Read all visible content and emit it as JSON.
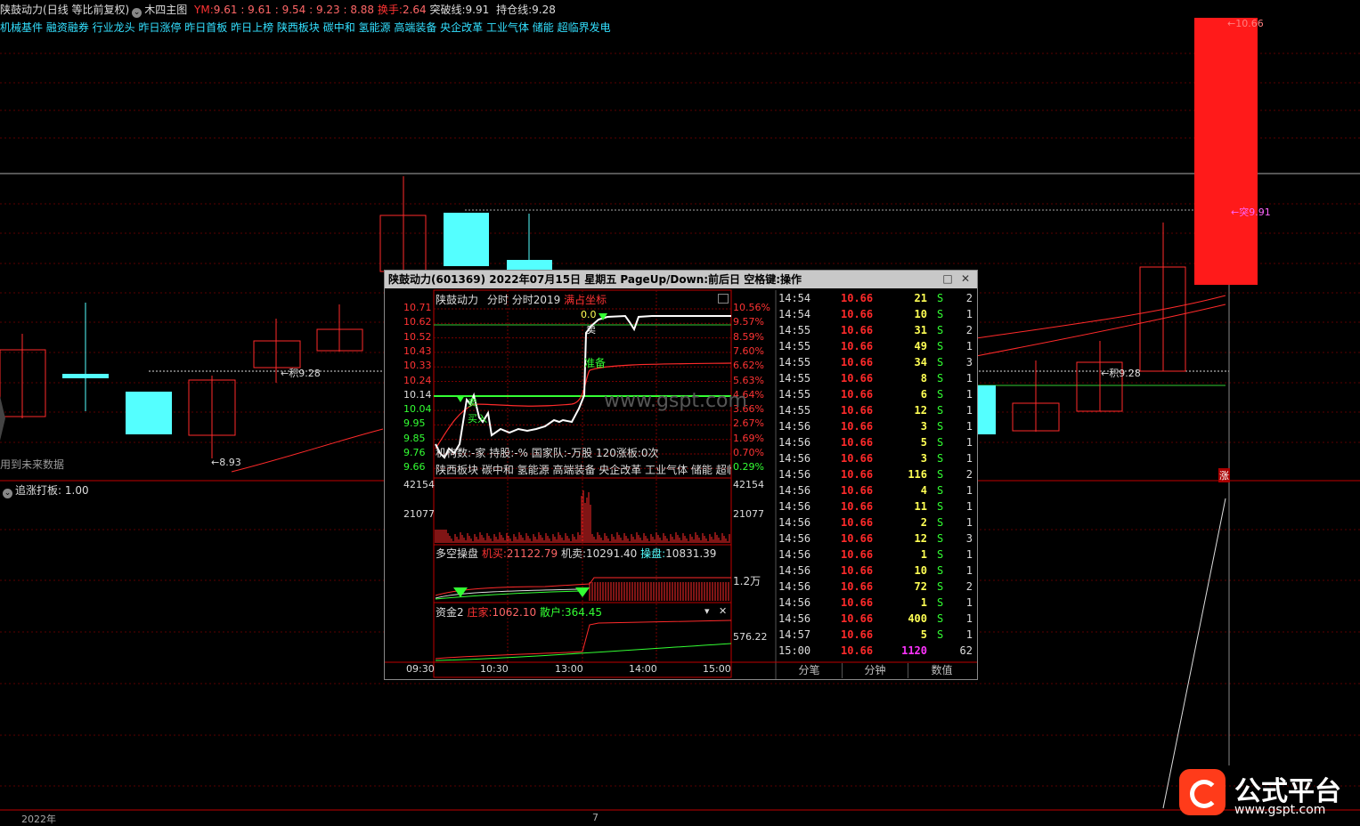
{
  "header": {
    "stock_name": "陕鼓动力",
    "chart_mode": "(日线 等比前复权)",
    "indicator_name": "木四主图",
    "ym_label": "YM:",
    "ym_values": "9.61 : 9.61 : 9.54 : 9.23 : 8.88",
    "turnover_label": "换手:",
    "turnover_value": "2.64",
    "breakout_label": "突破线:",
    "breakout_value": "9.91",
    "hold_label": "持仓线:",
    "hold_value": "9.28"
  },
  "concepts": "机械基件 融资融券 行业龙头 昨日涨停 昨日首板 昨日上榜 陕西板块 碳中和 氢能源 高端装备 央企改革 工业气体 储能 超临界发电",
  "main_chart": {
    "price_high_label": "←10.66",
    "breakout_label": "←突9.91",
    "hold_label_left": "←积9.28",
    "hold_label_right": "←积9.28",
    "low_label": "←8.93",
    "future_data_label": "用到未来数据",
    "zhang_label": "涨"
  },
  "sub_indicator": {
    "name": "追涨打板",
    "value": ": 1.00"
  },
  "bottom_axis": {
    "year_label": "2022年",
    "month_label": "7"
  },
  "colors": {
    "up": "#ff2a2a",
    "down": "#54ffff",
    "accent_yellow": "#ffff54",
    "green": "#33ff33",
    "magenta": "#ff33ff"
  },
  "popup": {
    "title": "陕鼓动力(601369) 2022年07月15日 星期五 PageUp/Down:前后日 空格键:操作",
    "chart_title": "陕鼓动力",
    "tab_fenshi": "分时",
    "tab_fenshi2019": "分时2019",
    "tab_full": "满占坐标",
    "left_prices": [
      "10.71",
      "10.62",
      "10.52",
      "10.43",
      "10.33",
      "10.24",
      "10.14",
      "10.04",
      "9.95",
      "9.85",
      "9.76",
      "9.66"
    ],
    "right_pcts": [
      "10.56%",
      "9.57%",
      "8.59%",
      "7.60%",
      "6.62%",
      "5.63%",
      "4.64%",
      "3.66%",
      "2.67%",
      "1.69%",
      "0.70%",
      "0.29%"
    ],
    "label_mai": "卖",
    "label_zhunbei": "准备",
    "label_mai2": "卖",
    "label_mairu": "买入",
    "label_top": "0.0",
    "info_line": "机构数:-家 持股:-% 国家队:-万股 120涨板:0次",
    "concept_line": "陕西板块 碳中和 氢能源 高端装备 央企改革 工业气体 储能 超临",
    "vol_top": "42154",
    "vol_mid": "21077",
    "duokong_label": "多空操盘",
    "jimai_label": "机买:",
    "jimai_value": "21122.79",
    "jimai2_label": "机卖:",
    "jimai2_value": "10291.40",
    "caopan_label": "操盘:",
    "caopan_value": "10831.39",
    "duokong_axis": "1.2万",
    "zijin_label": "资金2",
    "zhuangjia_label": "庄家:",
    "zhuangjia_value": "1062.10",
    "sanhu_label": "散户:",
    "sanhu_value": "364.45",
    "zijin_axis": "576.22",
    "time_labels": [
      "09:30",
      "10:30",
      "13:00",
      "14:00",
      "15:00"
    ],
    "watermark": "www.gspt.com",
    "ticks": [
      {
        "time": "14:54",
        "price": "10.66",
        "vol": "21",
        "side": "S",
        "n": "2"
      },
      {
        "time": "14:54",
        "price": "10.66",
        "vol": "10",
        "side": "S",
        "n": "1"
      },
      {
        "time": "14:55",
        "price": "10.66",
        "vol": "31",
        "side": "S",
        "n": "2"
      },
      {
        "time": "14:55",
        "price": "10.66",
        "vol": "49",
        "side": "S",
        "n": "1"
      },
      {
        "time": "14:55",
        "price": "10.66",
        "vol": "34",
        "side": "S",
        "n": "3"
      },
      {
        "time": "14:55",
        "price": "10.66",
        "vol": "8",
        "side": "S",
        "n": "1"
      },
      {
        "time": "14:55",
        "price": "10.66",
        "vol": "6",
        "side": "S",
        "n": "1"
      },
      {
        "time": "14:55",
        "price": "10.66",
        "vol": "12",
        "side": "S",
        "n": "1"
      },
      {
        "time": "14:56",
        "price": "10.66",
        "vol": "3",
        "side": "S",
        "n": "1"
      },
      {
        "time": "14:56",
        "price": "10.66",
        "vol": "5",
        "side": "S",
        "n": "1"
      },
      {
        "time": "14:56",
        "price": "10.66",
        "vol": "3",
        "side": "S",
        "n": "1"
      },
      {
        "time": "14:56",
        "price": "10.66",
        "vol": "116",
        "side": "S",
        "n": "2"
      },
      {
        "time": "14:56",
        "price": "10.66",
        "vol": "4",
        "side": "S",
        "n": "1"
      },
      {
        "time": "14:56",
        "price": "10.66",
        "vol": "11",
        "side": "S",
        "n": "1"
      },
      {
        "time": "14:56",
        "price": "10.66",
        "vol": "2",
        "side": "S",
        "n": "1"
      },
      {
        "time": "14:56",
        "price": "10.66",
        "vol": "12",
        "side": "S",
        "n": "3"
      },
      {
        "time": "14:56",
        "price": "10.66",
        "vol": "1",
        "side": "S",
        "n": "1"
      },
      {
        "time": "14:56",
        "price": "10.66",
        "vol": "10",
        "side": "S",
        "n": "1"
      },
      {
        "time": "14:56",
        "price": "10.66",
        "vol": "72",
        "side": "S",
        "n": "2"
      },
      {
        "time": "14:56",
        "price": "10.66",
        "vol": "1",
        "side": "S",
        "n": "1"
      },
      {
        "time": "14:56",
        "price": "10.66",
        "vol": "400",
        "side": "S",
        "n": "1"
      },
      {
        "time": "14:57",
        "price": "10.66",
        "vol": "5",
        "side": "S",
        "n": "1"
      },
      {
        "time": "15:00",
        "price": "10.66",
        "vol": "1120",
        "side": "",
        "n": "62"
      }
    ],
    "bottom_tabs": [
      "分笔",
      "分钟",
      "数值"
    ]
  },
  "logo": {
    "name": "公式平台",
    "url": "www.gspt.com"
  }
}
